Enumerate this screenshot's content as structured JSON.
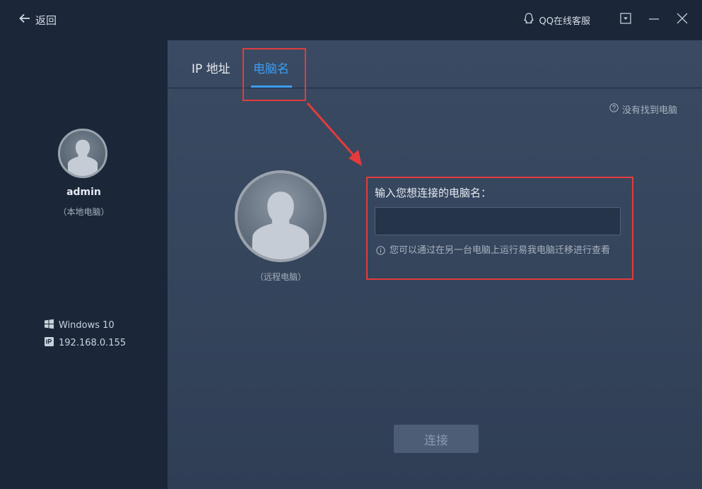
{
  "titlebar": {
    "back_label": "返回",
    "qq_support": "QQ在线客服"
  },
  "sidebar": {
    "username": "admin",
    "local_label": "（本地电脑）",
    "os": "Windows 10",
    "ip": "192.168.0.155"
  },
  "tabs": [
    {
      "label": "IP 地址"
    },
    {
      "label": "电脑名",
      "active": true
    }
  ],
  "main": {
    "not_found": "没有找到电脑",
    "remote_label": "（远程电脑）",
    "input_label": "输入您想连接的电脑名：",
    "input_value": "",
    "hint": "您可以通过在另一台电脑上运行易我电脑迁移进行查看",
    "connect_label": "连接"
  },
  "colors": {
    "accent": "#3d9df2",
    "highlight": "#e23c3c"
  }
}
